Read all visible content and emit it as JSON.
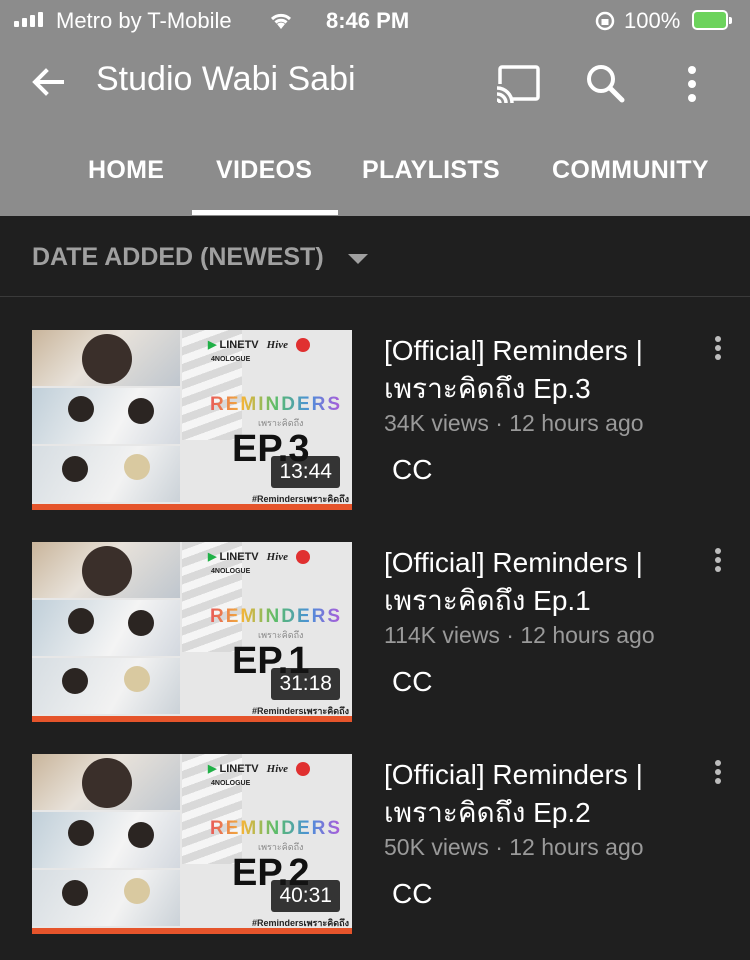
{
  "status": {
    "carrier": "Metro by T-Mobile",
    "time": "8:46 PM",
    "battery": "100%"
  },
  "header": {
    "title": "Studio Wabi Sabi",
    "icons": [
      "back-arrow-icon",
      "cast-icon",
      "search-icon",
      "more-vert-icon"
    ]
  },
  "tabs": [
    {
      "label": "HOME"
    },
    {
      "label": "VIDEOS",
      "selected": true
    },
    {
      "label": "PLAYLISTS"
    },
    {
      "label": "COMMUNITY"
    }
  ],
  "sort": {
    "label": "DATE ADDED (NEWEST)"
  },
  "videos": [
    {
      "title": "[Official] Reminders | เพราะคิดถึง Ep.3",
      "meta": "34K views · 12 hours ago",
      "badge": "CC",
      "duration": "13:44",
      "thumb": {
        "ep": "EP.3",
        "show": "REMINDERS",
        "show_sub": "เพราะคิดถึง",
        "brand": "LINETV",
        "brand2": "Hive",
        "brand3": "4NOLOGUE",
        "tag": "#Remindersเพราะคิดถึง"
      }
    },
    {
      "title": "[Official] Reminders | เพราะคิดถึง Ep.1",
      "meta": "114K views · 12 hours ago",
      "badge": "CC",
      "duration": "31:18",
      "thumb": {
        "ep": "EP.1",
        "show": "REMINDERS",
        "show_sub": "เพราะคิดถึง",
        "brand": "LINETV",
        "brand2": "Hive",
        "brand3": "4NOLOGUE",
        "tag": "#Remindersเพราะคิดถึง"
      }
    },
    {
      "title": "[Official] Reminders | เพราะคิดถึง Ep.2",
      "meta": "50K views · 12 hours ago",
      "badge": "CC",
      "duration": "40:31",
      "thumb": {
        "ep": "EP.2",
        "show": "REMINDERS",
        "show_sub": "เพราะคิดถึง",
        "brand": "LINETV",
        "brand2": "Hive",
        "brand3": "4NOLOGUE",
        "tag": "#Remindersเพราะคิดถึง"
      }
    }
  ],
  "colors": {
    "appbar": "#8c8c8c",
    "background": "#1f1f1f",
    "accent_bar": "#e5542b",
    "battery": "#6cd35c"
  }
}
